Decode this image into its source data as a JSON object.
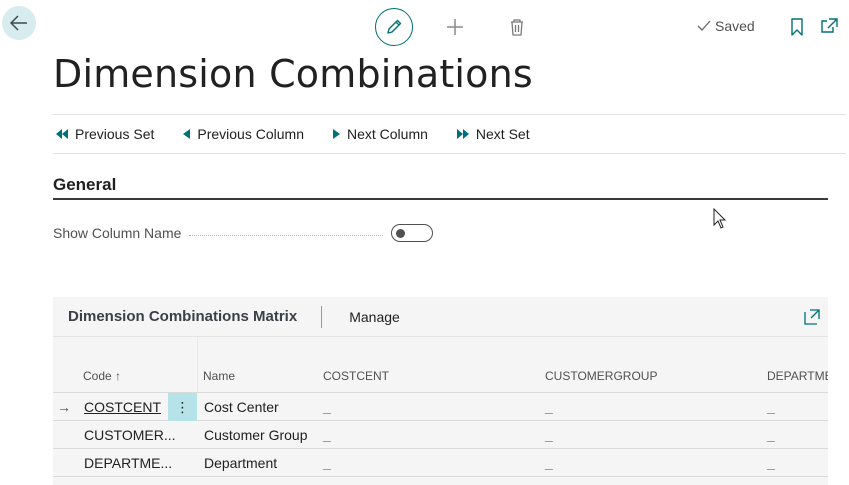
{
  "toolbar": {
    "back_icon": "arrow-left-icon",
    "edit_icon": "pencil-icon",
    "new_icon": "plus-icon",
    "delete_icon": "trash-icon",
    "saved_label": "Saved",
    "bookmark_icon": "bookmark-icon",
    "popout_icon": "open-in-new-window-icon"
  },
  "page": {
    "title": "Dimension Combinations"
  },
  "actions": [
    {
      "label": "Previous Set",
      "icon": "double-triangle-left-icon"
    },
    {
      "label": "Previous Column",
      "icon": "triangle-left-icon"
    },
    {
      "label": "Next Column",
      "icon": "triangle-right-icon"
    },
    {
      "label": "Next Set",
      "icon": "double-triangle-right-icon"
    }
  ],
  "general": {
    "title": "General",
    "show_column_name_label": "Show Column Name",
    "show_column_name_value": false
  },
  "matrix": {
    "title": "Dimension Combinations Matrix",
    "manage_label": "Manage",
    "columns": {
      "code": "Code ↑",
      "name": "Name",
      "col1": "COSTCENT",
      "col2": "CUSTOMERGROUP",
      "col3": "DEPARTMENT"
    },
    "rows": [
      {
        "code": "COSTCENT",
        "name": "Cost Center",
        "v1": "_",
        "v2": "_",
        "v3": "_",
        "selected": true
      },
      {
        "code": "CUSTOMER...",
        "name": "Customer Group",
        "v1": "_",
        "v2": "_",
        "v3": "_",
        "selected": false
      },
      {
        "code": "DEPARTME...",
        "name": "Department",
        "v1": "_",
        "v2": "_",
        "v3": "_",
        "selected": false
      }
    ],
    "row_arrow": "→",
    "row_menu": "⋮"
  },
  "colors": {
    "accent": "#00707a",
    "back_button_bg": "#d6ecef",
    "row_menu_bg": "#b6e3e8"
  }
}
